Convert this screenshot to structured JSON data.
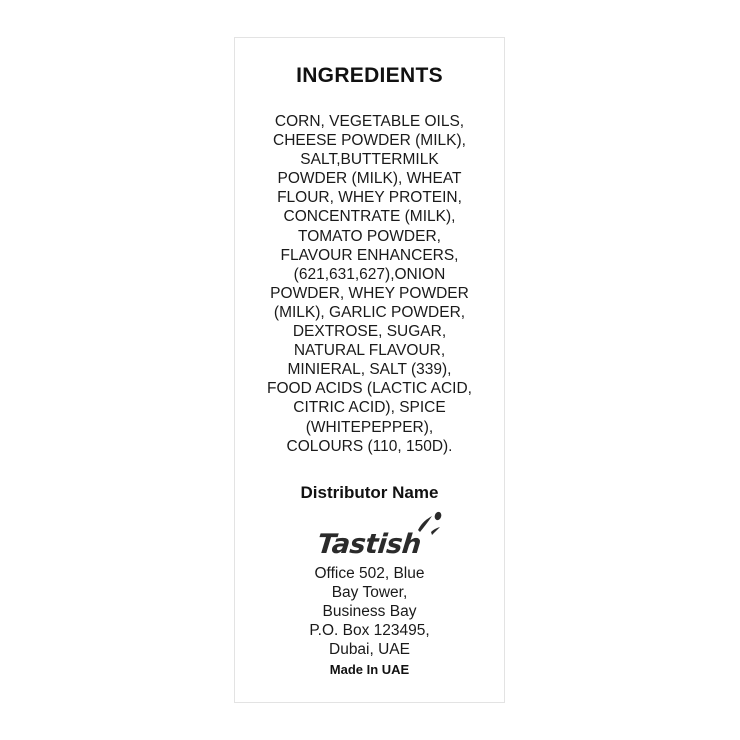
{
  "label": {
    "ingredients_heading": "INGREDIENTS",
    "ingredient_lines": [
      "CORN, VEGETABLE OILS,",
      "CHEESE POWDER (MILK),",
      "SALT,BUTTERMILK",
      "POWDER (MILK), WHEAT",
      "FLOUR, WHEY PROTEIN,",
      "CONCENTRATE (MILK),",
      "TOMATO POWDER,",
      "FLAVOUR ENHANCERS,",
      "(621,631,627),ONION",
      "POWDER, WHEY POWDER",
      "(MILK), GARLIC POWDER,",
      "DEXTROSE, SUGAR,",
      "NATURAL FLAVOUR,",
      "MINIERAL, SALT (339),",
      "FOOD ACIDS (LACTIC ACID,",
      "CITRIC ACID), SPICE",
      "(WHITEPEPPER),",
      "COLOURS (110, 150D)."
    ],
    "distributor_heading": "Distributor Name",
    "brand": {
      "logo_text": "Tastish",
      "logo_color": "#2b2b2b"
    },
    "address_lines": [
      "Office 502, Blue",
      "Bay Tower,",
      "Business Bay",
      "P.O. Box 123495,",
      "Dubai, UAE"
    ],
    "origin_note": "Made In UAE"
  }
}
